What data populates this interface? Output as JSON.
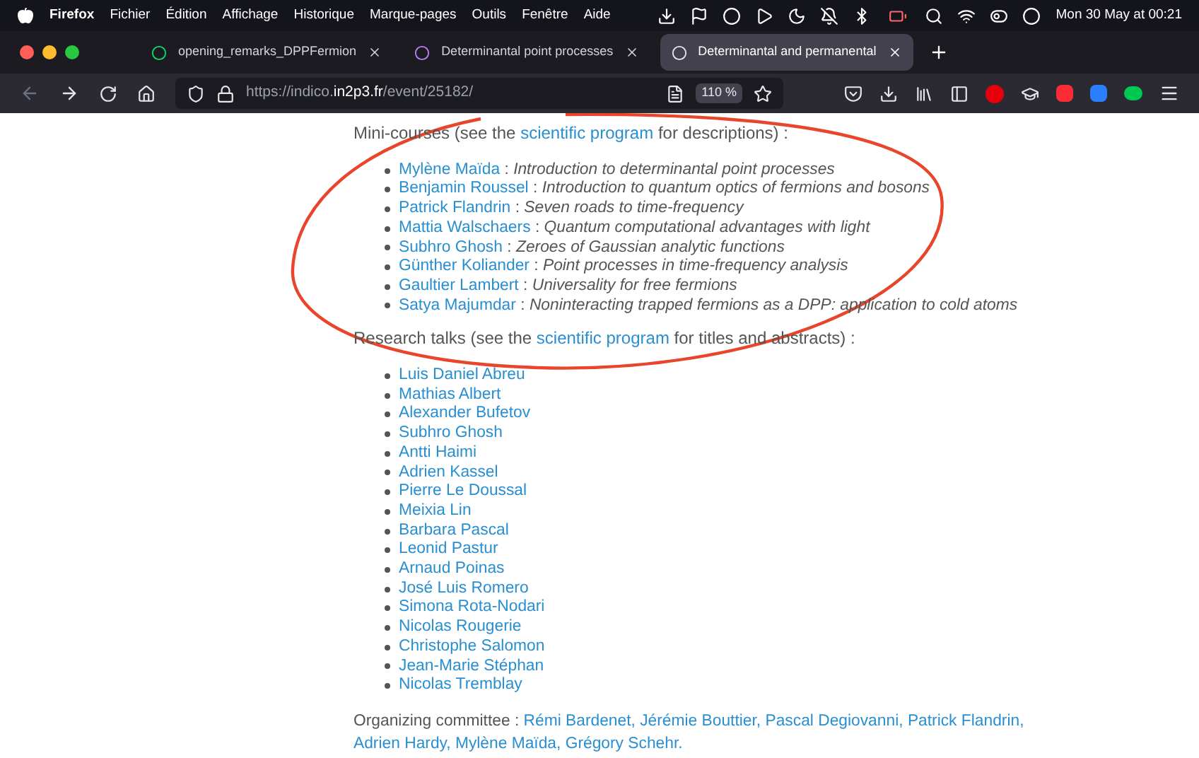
{
  "menu_bar": {
    "app": "Firefox",
    "items": [
      "Fichier",
      "Édition",
      "Affichage",
      "Historique",
      "Marque-pages",
      "Outils",
      "Fenêtre",
      "Aide"
    ],
    "clock": "Mon 30 May at 00:21"
  },
  "tabs": [
    {
      "title": "opening_remarks_DPPFermion",
      "selected": false
    },
    {
      "title": "Determinantal point processes",
      "selected": false
    },
    {
      "title": "Determinantal and permanental",
      "selected": true
    }
  ],
  "address_bar": {
    "scheme": "https://indico.",
    "domain": "in2p3.fr",
    "path": "/event/25182/",
    "zoom": "110 %"
  },
  "mini_courses": {
    "before": "Mini-courses (see the",
    "link": "scientific program",
    "after": "for descriptions) :",
    "items": [
      {
        "speaker": "Mylène Maïda",
        "separator": ":",
        "title": "Introduction to determinantal point processes"
      },
      {
        "speaker": "Benjamin Roussel",
        "separator": ":",
        "title": "Introduction to quantum optics of fermions and bosons"
      },
      {
        "speaker": "Patrick Flandrin",
        "separator": ":",
        "title": "Seven roads to time-frequency"
      },
      {
        "speaker": "Mattia Walschaers",
        "separator": ":",
        "title": "Quantum computational advantages with light"
      },
      {
        "speaker": "Subhro Ghosh",
        "separator": ":",
        "title": "Zeroes of Gaussian analytic functions"
      },
      {
        "speaker": "Günther Koliander",
        "separator": ":",
        "title": "Point processes in time-frequency analysis"
      },
      {
        "speaker": "Gaultier Lambert",
        "separator": ":",
        "title": "Universality for free fermions"
      },
      {
        "speaker": "Satya Majumdar",
        "separator": ":",
        "title": "Noninteracting trapped fermions as a DPP: application to cold atoms"
      }
    ]
  },
  "research_talks": {
    "before": "Research talks (see the",
    "link": "scientific program",
    "after": "for titles and abstracts) :",
    "speakers": [
      "Luis Daniel Abreu",
      "Mathias Albert",
      "Alexander Bufetov",
      "Subhro Ghosh",
      "Antti Haimi",
      "Adrien Kassel",
      "Pierre Le Doussal",
      "Meixia Lin",
      "Barbara Pascal",
      "Leonid Pastur",
      "Arnaud Poinas",
      "José Luis Romero",
      "Simona Rota-Nodari",
      "Nicolas Rougerie",
      "Christophe Salomon",
      "Jean-Marie Stéphan",
      "Nicolas Tremblay"
    ]
  },
  "organizing_committee": {
    "label": "Organizing committee :",
    "members": [
      "Rémi Bardenet,",
      "Jérémie Bouttier,",
      "Pascal Degiovanni,",
      "Patrick Flandrin,",
      "Adrien Hardy,",
      "Mylène Maïda,",
      "Grégory Schehr."
    ]
  }
}
